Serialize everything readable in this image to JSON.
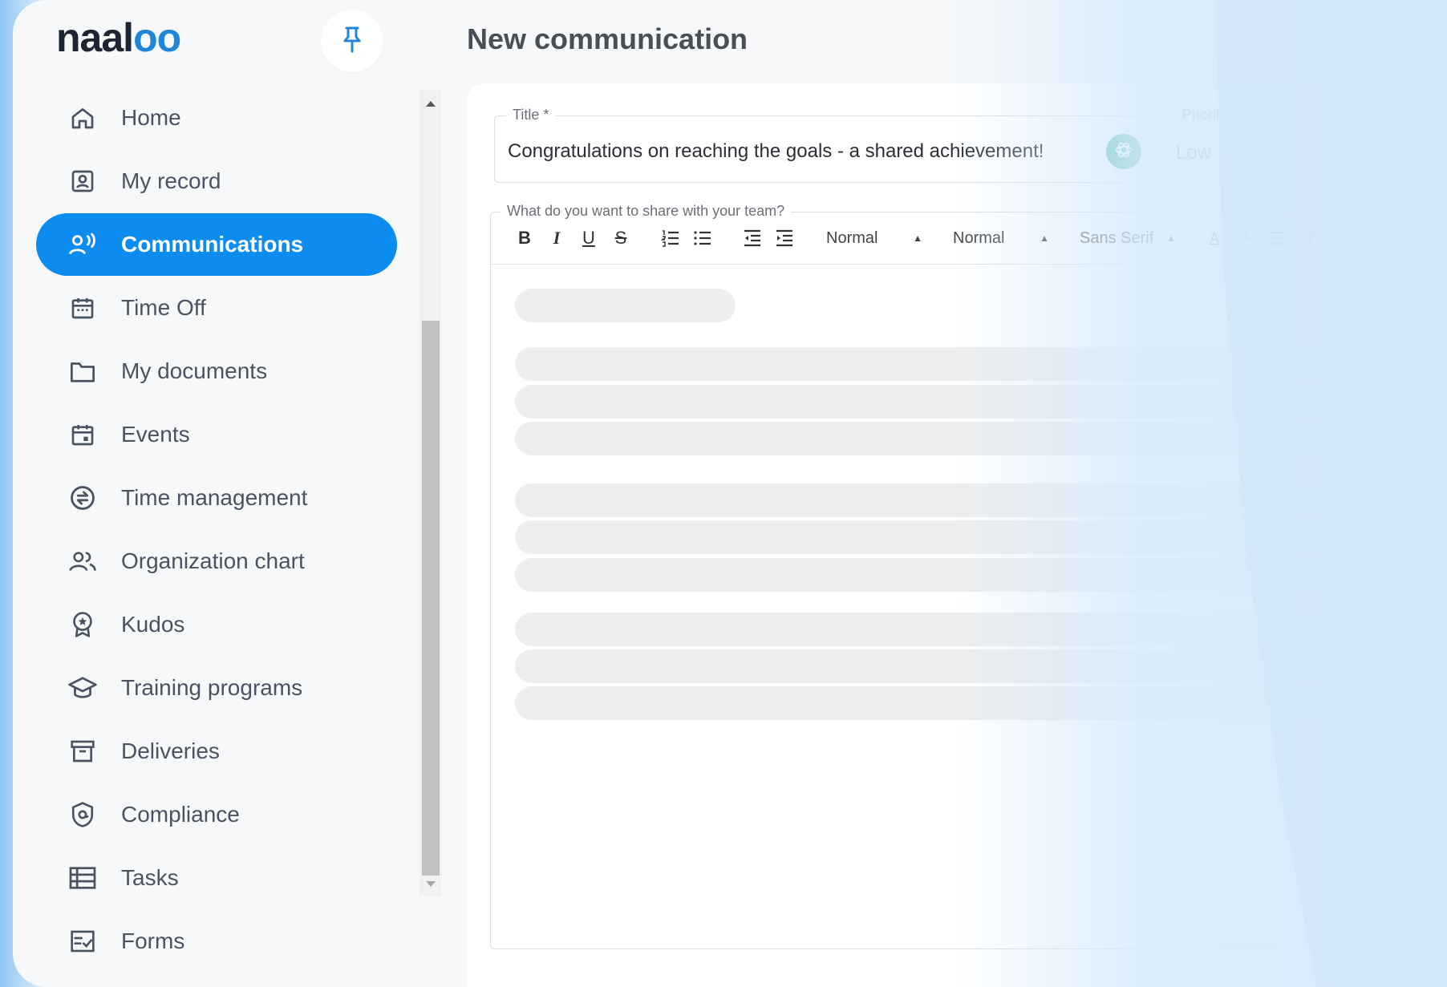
{
  "app": {
    "logo_prefix": "naal",
    "logo_suffix": "oo",
    "page_title": "New communication"
  },
  "sidebar": {
    "items": [
      {
        "label": "Home",
        "icon": "home-icon"
      },
      {
        "label": "My record",
        "icon": "id-card-icon"
      },
      {
        "label": "Communications",
        "icon": "speaking-person-icon",
        "active": true
      },
      {
        "label": "Time Off",
        "icon": "calendar-icon"
      },
      {
        "label": "My documents",
        "icon": "folder-icon"
      },
      {
        "label": "Events",
        "icon": "calendar-event-icon"
      },
      {
        "label": "Time management",
        "icon": "clock-exchange-icon"
      },
      {
        "label": "Organization chart",
        "icon": "people-icon"
      },
      {
        "label": "Kudos",
        "icon": "award-icon"
      },
      {
        "label": "Training programs",
        "icon": "graduation-cap-icon"
      },
      {
        "label": "Deliveries",
        "icon": "archive-box-icon"
      },
      {
        "label": "Compliance",
        "icon": "shield-icon"
      },
      {
        "label": "Tasks",
        "icon": "table-list-icon"
      },
      {
        "label": "Forms",
        "icon": "form-check-icon"
      }
    ]
  },
  "form": {
    "title_label": "Title *",
    "title_value": "Congratulations on reaching the goals - a shared achievement!",
    "priority_label": "Priority",
    "priority_value": "Low",
    "editor_label": "What do you want to share with your team?"
  },
  "toolbar": {
    "bold": "B",
    "italic": "I",
    "underline": "U",
    "strike": "S",
    "header_select": "Normal",
    "size_select": "Normal",
    "font_select": "Sans Serif"
  },
  "colors": {
    "accent": "#0d8cf0",
    "gpt": "#3fb59b"
  }
}
